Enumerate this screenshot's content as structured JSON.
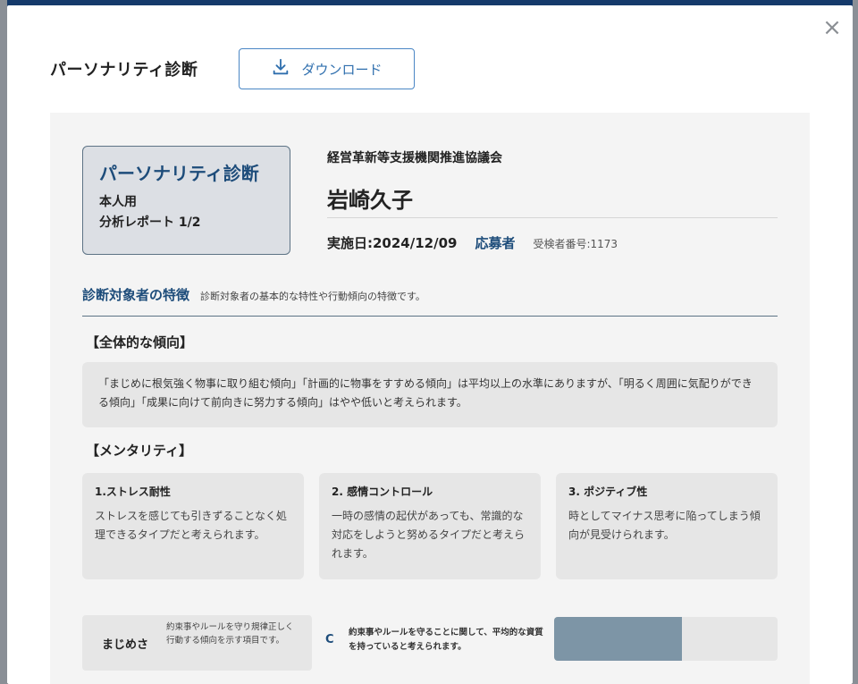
{
  "modal": {
    "title": "パーソナリティ診断",
    "close_label": "×",
    "download_label": "ダウンロード"
  },
  "report": {
    "title_card": {
      "title": "パーソナリティ診断",
      "audience": "本人用",
      "page": "分析レポート 1/2"
    },
    "organization": "経営革新等支援機関推進協議会",
    "person_name": "岩崎久子",
    "date": "実施日:2024/12/09",
    "role": "応募者",
    "examinee_no": "受検者番号:1173",
    "section": {
      "title": "診断対象者の特徴",
      "description": "診断対象者の基本的な特性や行動傾向の特徴です。"
    },
    "overall": {
      "title": "【全体的な傾向】",
      "text": "「まじめに根気強く物事に取り組む傾向」「計画的に物事をすすめる傾向」は平均以上の水準にありますが、「明るく周囲に気配りができる傾向」「成果に向けて前向きに努力する傾向」はやや低いと考えられます。"
    },
    "mentality": {
      "title": "【メンタリティ】",
      "cards": [
        {
          "title": "1.ストレス耐性",
          "text": "ストレスを感じても引きずることなく処理できるタイプだと考えられます。"
        },
        {
          "title": "2. 感情コントロール",
          "text": "一時の感情の起伏があっても、常識的な対応をしようと努めるタイプだと考えられます。"
        },
        {
          "title": "3. ポジティブ性",
          "text": "時としてマイナス思考に陥ってしまう傾向が見受けられます。"
        }
      ]
    },
    "trait": {
      "name": "まじめさ",
      "description": "約束事やルールを守り規律正しく行動する傾向を示す項目です。",
      "grade": "C",
      "comment": "約束事やルールを守ることに関して、平均的な資質を持っていると考えられます。",
      "level": 0.57,
      "bar_color": "#7d95a6"
    }
  }
}
